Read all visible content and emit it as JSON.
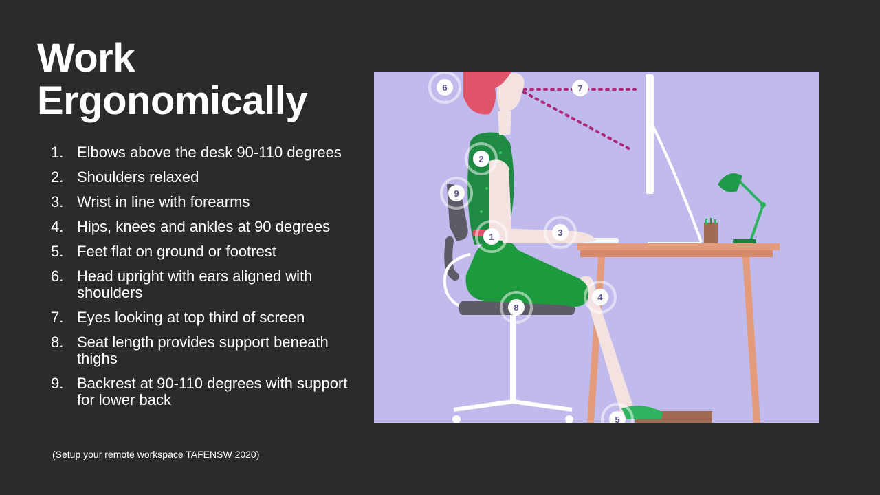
{
  "slide": {
    "title_line1": "Work",
    "title_line2": "Ergonomically",
    "items": [
      {
        "num": "1.",
        "text": "Elbows above the desk 90-110 degrees"
      },
      {
        "num": "2.",
        "text": "Shoulders relaxed"
      },
      {
        "num": "3.",
        "text": "Wrist in line with forearms"
      },
      {
        "num": "4.",
        "text": "Hips, knees and ankles at 90 degrees"
      },
      {
        "num": "5.",
        "text": "Feet flat on ground or footrest"
      },
      {
        "num": "6.",
        "text": "Head upright with ears aligned with shoulders"
      },
      {
        "num": "7.",
        "text": "Eyes looking at top third of screen"
      },
      {
        "num": "8.",
        "text": "Seat length provides support beneath thighs"
      },
      {
        "num": "9.",
        "text": "Backrest at 90-110 degrees with support for lower back"
      }
    ],
    "citation": "(Setup your remote workspace TAFENSW 2020)"
  },
  "illustration": {
    "markers": [
      "1",
      "2",
      "3",
      "4",
      "5",
      "6",
      "7",
      "8",
      "9"
    ],
    "colors": {
      "background": "#c0bbec",
      "shirt": "#1f8a44",
      "pants": "#1e9a3e",
      "hair": "#e0556a",
      "skin": "#f3e2e0",
      "desk": "#e39b7b",
      "chair": "#5c5c66",
      "lamp": "#2fb35f",
      "sightline": "#b0287a"
    }
  }
}
